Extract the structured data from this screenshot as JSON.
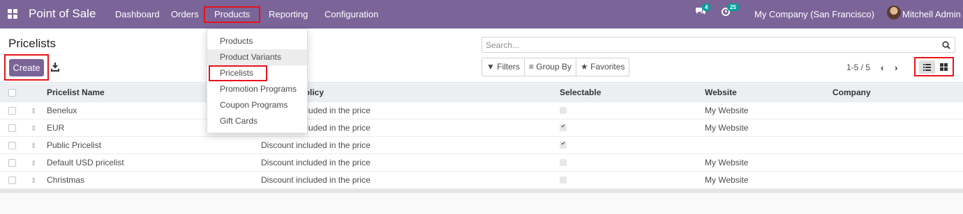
{
  "navbar": {
    "app_name": "Point of Sale",
    "menus": [
      "Dashboard",
      "Orders",
      "Products",
      "Reporting",
      "Configuration"
    ],
    "messages_badge": "4",
    "activities_badge": "25",
    "company": "My Company (San Francisco)",
    "user": "Mitchell Admin"
  },
  "control_panel": {
    "title": "Pricelists",
    "create_label": "Create",
    "search_placeholder": "Search...",
    "filters_label": "Filters",
    "group_by_label": "Group By",
    "favorites_label": "Favorites",
    "pager": "1-5 / 5"
  },
  "dropdown": {
    "items": [
      "Products",
      "Product Variants",
      "Pricelists",
      "Promotion Programs",
      "Coupon Programs",
      "Gift Cards"
    ]
  },
  "table": {
    "columns": [
      "Pricelist Name",
      "Discount Policy",
      "Selectable",
      "Website",
      "Company"
    ],
    "rows": [
      {
        "name": "Benelux",
        "policy": "Discount included in the price",
        "selectable": false,
        "website": "My Website",
        "company": ""
      },
      {
        "name": "EUR",
        "policy": "Discount included in the price",
        "selectable": true,
        "website": "My Website",
        "company": ""
      },
      {
        "name": "Public Pricelist",
        "policy": "Discount included in the price",
        "selectable": true,
        "website": "",
        "company": ""
      },
      {
        "name": "Default USD pricelist",
        "policy": "Discount included in the price",
        "selectable": false,
        "website": "My Website",
        "company": ""
      },
      {
        "name": "Christmas",
        "policy": "Discount included in the price",
        "selectable": false,
        "website": "My Website",
        "company": ""
      }
    ]
  },
  "colors": {
    "brand": "#7a6498",
    "highlight": "#e8121a",
    "badge": "#00a09d"
  }
}
